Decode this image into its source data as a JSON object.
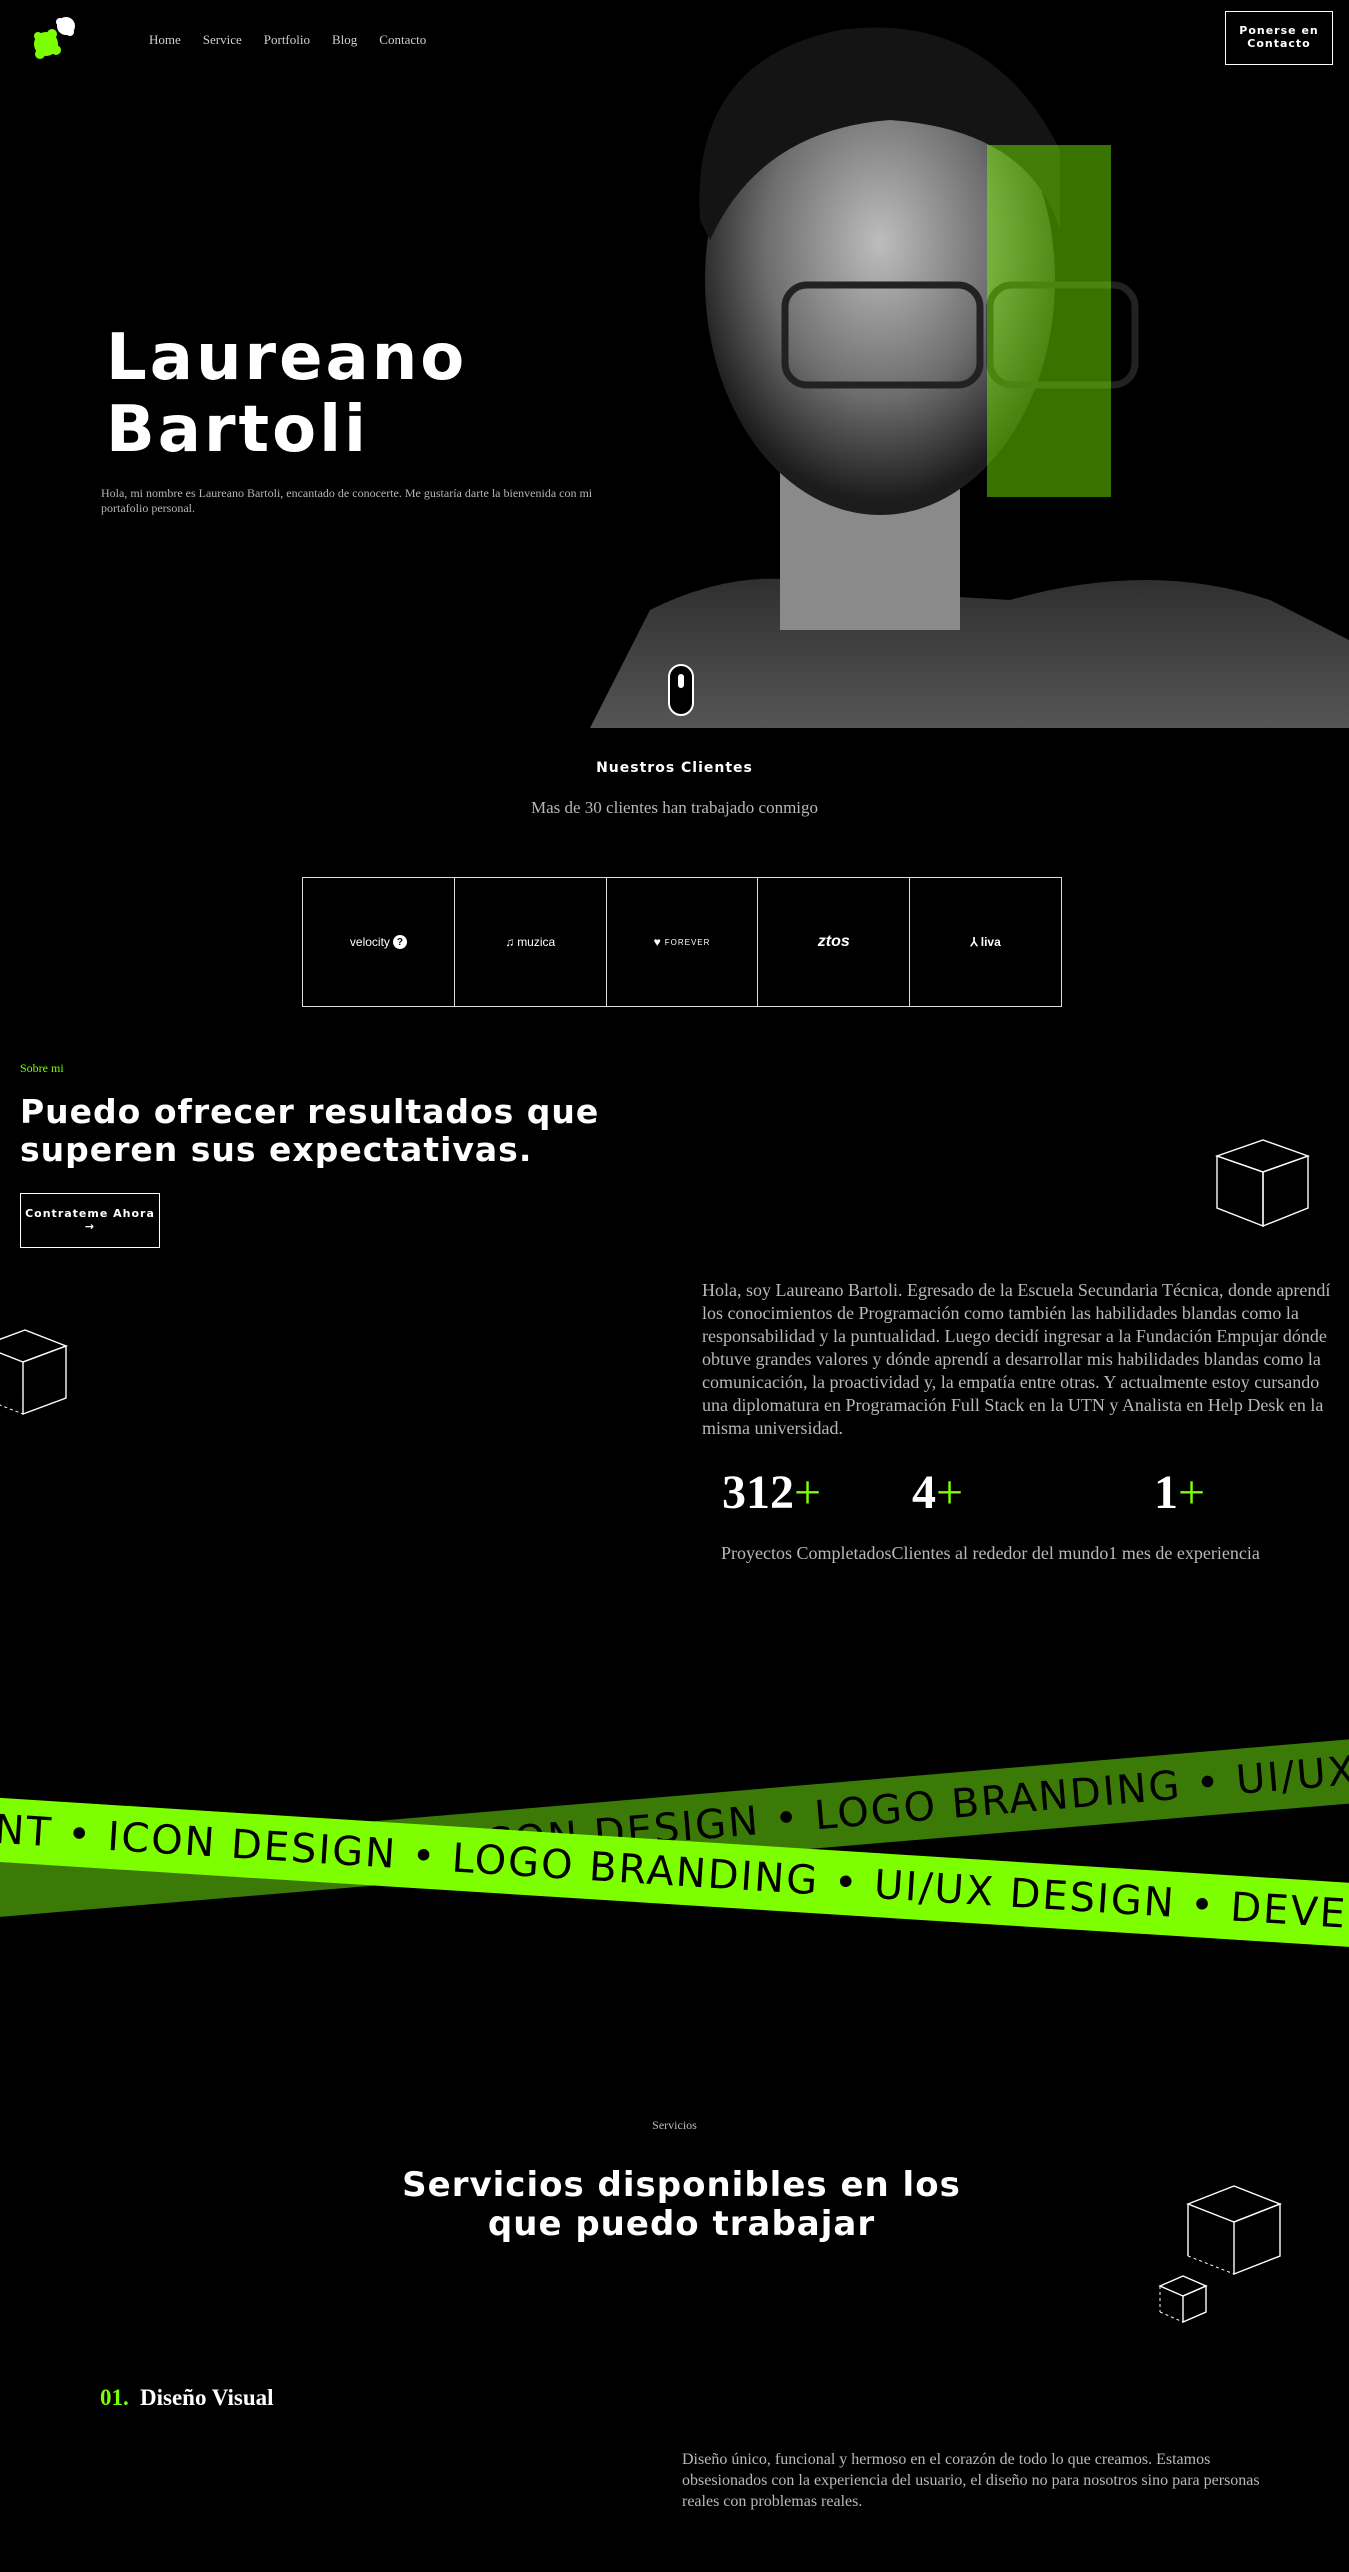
{
  "header": {
    "nav": [
      "Home",
      "Service",
      "Portfolio",
      "Blog",
      "Contacto"
    ],
    "contact_button": "Ponerse en Contacto"
  },
  "hero": {
    "title_line1": "Laureano",
    "title_line2": "Bartoli",
    "subtitle": "Hola, mi nombre es Laureano Bartoli, encantado de conocerte. Me gustaría darte la bienvenida con mi portafolio personal."
  },
  "clients": {
    "title": "Nuestros Clientes",
    "subtitle": "Mas de 30 clientes han trabajado conmigo",
    "logos": [
      "velocity",
      "muzica",
      "FOREVER",
      "ztos",
      "liva"
    ]
  },
  "about": {
    "kicker": "Sobre mi",
    "title": "Puedo ofrecer resultados que superen sus expectativas.",
    "hire_button": "Contrateme Ahora →",
    "text": "Hola, soy Laureano Bartoli. Egresado de la Escuela Secundaria Técnica, donde aprendí los conocimientos de Programación como también las habilidades blandas como la responsabilidad y la puntualidad. Luego decidí ingresar a la Fundación Empujar dónde obtuve grandes valores y dónde aprendí a desarrollar mis habilidades blandas como la comunicación, la proactividad y, la empatía entre otras. Y actualmente estoy cursando una diplomatura en Programación Full Stack en la UTN y Analista en Help Desk en la misma universidad.",
    "stats": [
      {
        "value": "312",
        "plus": "+"
      },
      {
        "value": "4",
        "plus": "+"
      },
      {
        "value": "1",
        "plus": "+"
      }
    ],
    "stat_labels": "Proyectos CompletadosClientes al rededor del mundo1 mes de experiencia"
  },
  "tapes": {
    "dark": "ICON DESIGN  •  LOGO BRANDING  •  UI/UX DESIGN  •  DEVELOPMENT  •  ICON DESIGN  •  LOGO BRANDING",
    "bright": "DEVELOPMENT  •  ICON DESIGN  •  LOGO BRANDING  •  UI/UX DESIGN  •  DEVELOPMENT"
  },
  "services": {
    "kicker": "Servicios",
    "title": "Servicios disponibles en los que puedo trabajar",
    "items": [
      {
        "num": "01.",
        "name": "Diseño Visual",
        "desc": "Diseño único, funcional y hermoso en el corazón de todo lo que creamos. Estamos obsesionados con la experiencia del usuario, el diseño no para nosotros sino para personas reales con problemas reales."
      }
    ]
  },
  "colors": {
    "accent": "#7cff00",
    "accent_dark": "#3c7a08",
    "background": "#000000"
  }
}
